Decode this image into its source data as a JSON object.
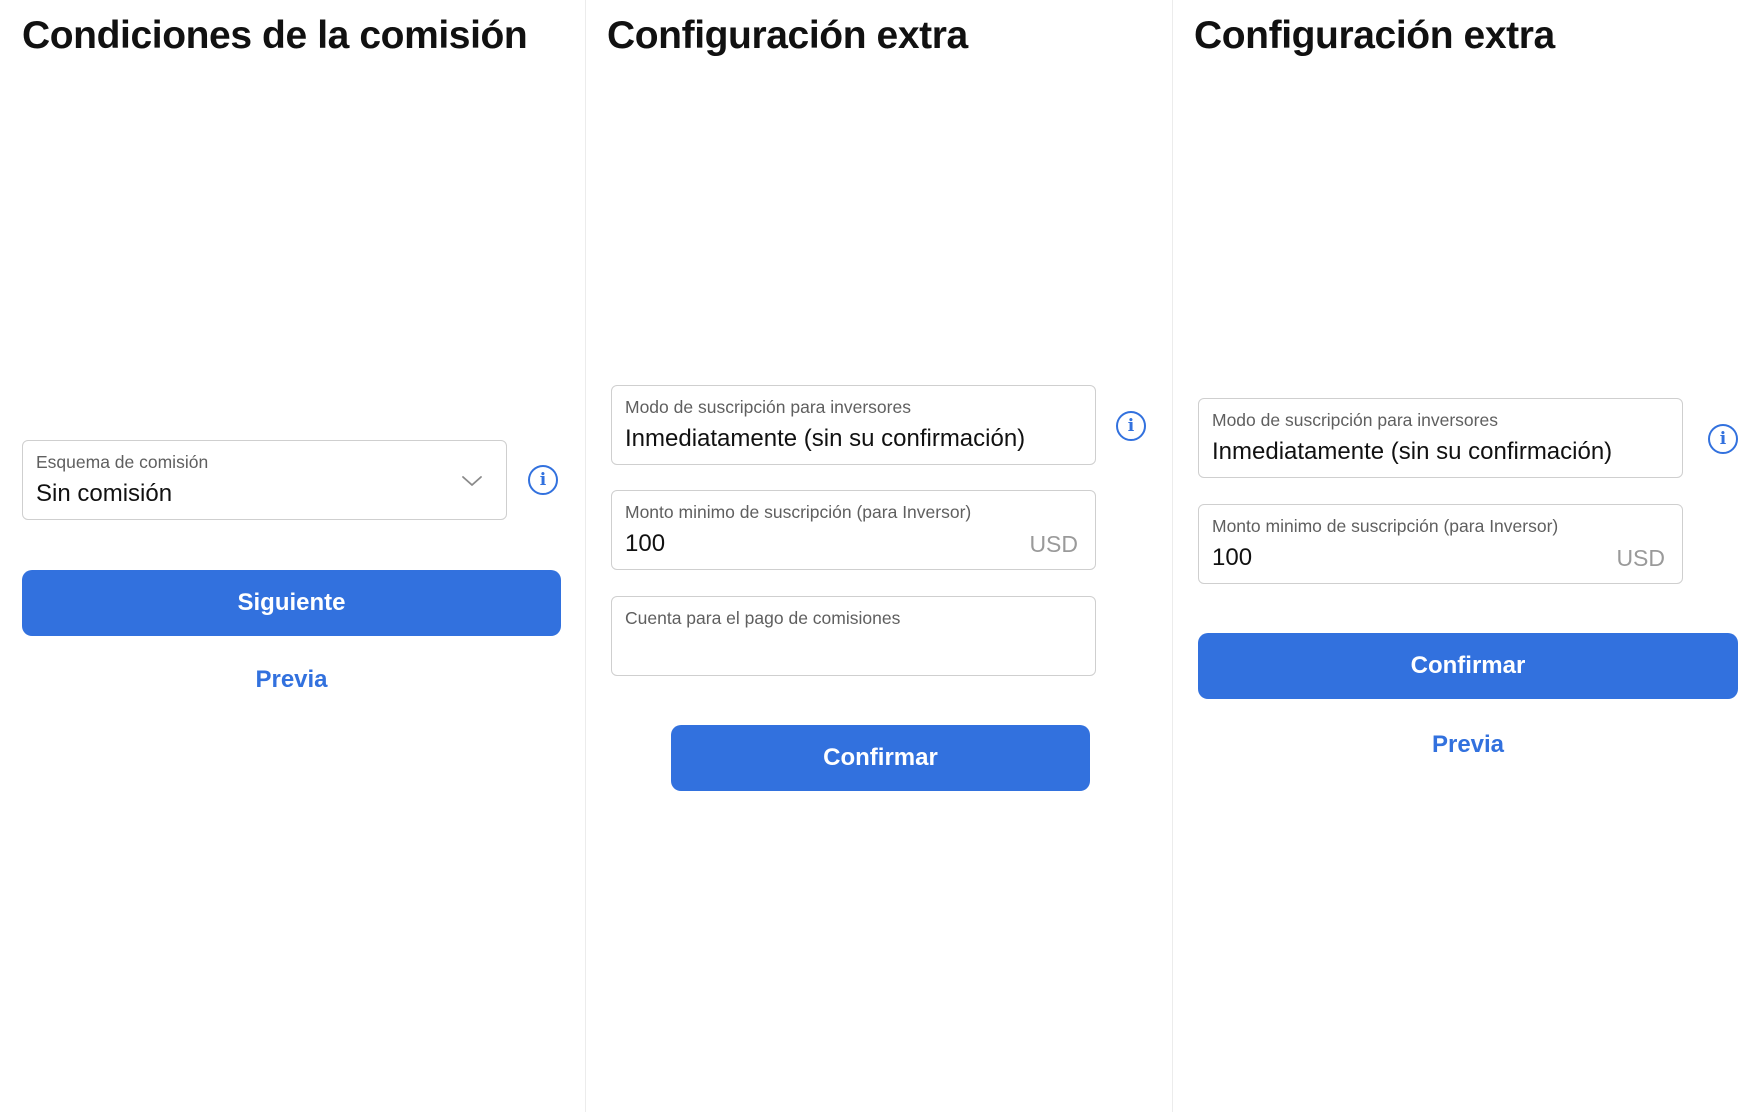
{
  "colors": {
    "accent": "#3271de",
    "border": "#cfcfcf",
    "label": "#5f5f5f",
    "suffix": "#9a9a9a"
  },
  "panel1": {
    "title": "Condiciones de la comisión",
    "commission_scheme": {
      "label": "Esquema de comisión",
      "value": "Sin comisión",
      "icon": "chevron-down-icon"
    },
    "info_icon": "info-icon",
    "next_button": "Siguiente",
    "previous_link": "Previa"
  },
  "panel2": {
    "title": "Configuración extra",
    "subscription_mode": {
      "label": "Modo de suscripción para inversores",
      "value": "Inmediatamente (sin su confirmación)"
    },
    "min_subscription": {
      "label": "Monto minimo de suscripción (para Inversor)",
      "value": "100",
      "suffix": "USD"
    },
    "fee_account": {
      "label": "Cuenta para el pago de comisiones",
      "value": ""
    },
    "info_icon": "info-icon",
    "confirm_button": "Confirmar"
  },
  "panel3": {
    "title": "Configuración extra",
    "subscription_mode": {
      "label": "Modo de suscripción para inversores",
      "value": "Inmediatamente (sin su confirmación)"
    },
    "min_subscription": {
      "label": "Monto minimo de suscripción (para Inversor)",
      "value": "100",
      "suffix": "USD"
    },
    "info_icon": "info-icon",
    "confirm_button": "Confirmar",
    "previous_link": "Previa"
  }
}
